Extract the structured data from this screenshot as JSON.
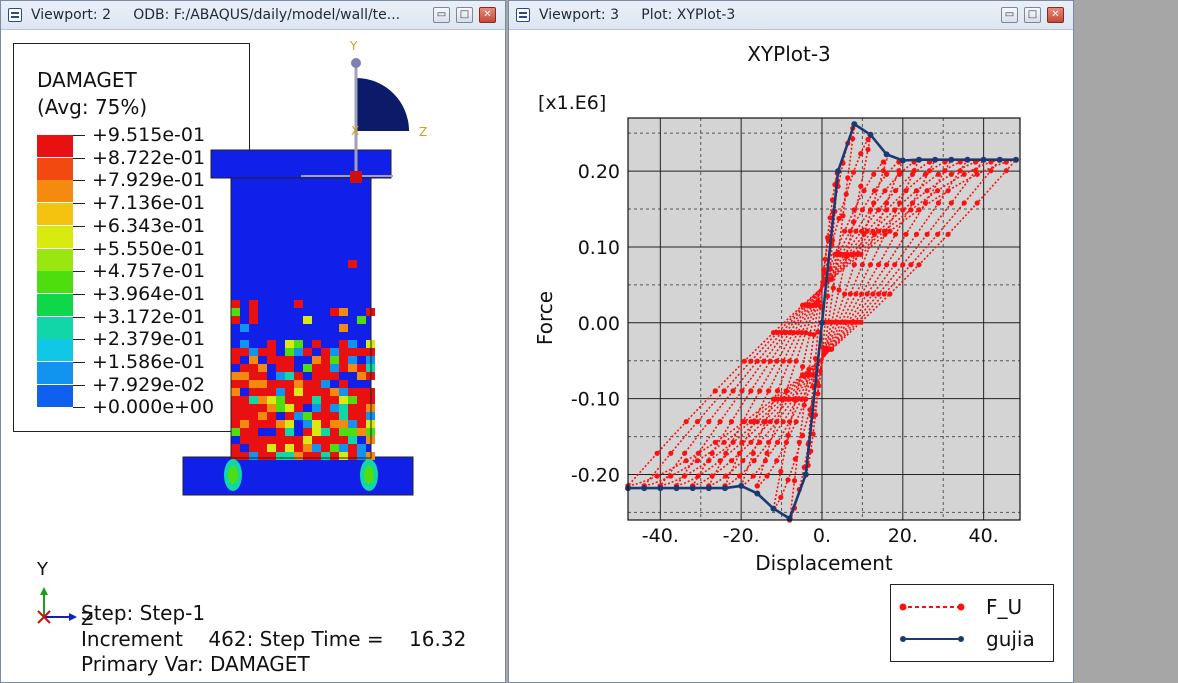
{
  "viewport2": {
    "title": "Viewport: 2     ODB: F:/ABAQUS/daily/model/wall/te...",
    "legend": {
      "title": "DAMAGET",
      "subtitle": "(Avg: 75%)",
      "levels": [
        "+9.515e-01",
        "+8.722e-01",
        "+7.929e-01",
        "+7.136e-01",
        "+6.343e-01",
        "+5.550e-01",
        "+4.757e-01",
        "+3.964e-01",
        "+3.172e-01",
        "+2.379e-01",
        "+1.586e-01",
        "+7.929e-02",
        "+0.000e+00"
      ],
      "colors": [
        "#e81010",
        "#f04a10",
        "#f58a10",
        "#f5c210",
        "#d8ea10",
        "#9ae610",
        "#4ede10",
        "#10d64a",
        "#10d6a8",
        "#10c8e6",
        "#1094f0",
        "#1060f0",
        "#1020e8"
      ]
    },
    "triad": {
      "y": "Y",
      "z": "Z",
      "x": "X"
    },
    "info": {
      "step": "Step: Step-1",
      "increment": "Increment    462: Step Time =    16.32",
      "primary": "Primary Var: DAMAGET"
    }
  },
  "viewport3": {
    "title": "Viewport: 3     Plot: XYPlot-3"
  },
  "chart_data": {
    "type": "line",
    "title": "XYPlot-3",
    "xlabel": "Displacement",
    "ylabel": "Force",
    "y_multiplier": "[x1.E6]",
    "xlim": [
      -48,
      49
    ],
    "ylim": [
      -0.26,
      0.27
    ],
    "x_ticks": [
      -40,
      -20,
      0,
      20,
      40
    ],
    "x_tick_labels": [
      "-40.",
      "-20.",
      "0.",
      "20.",
      "40."
    ],
    "y_ticks": [
      0.2,
      0.1,
      0.0,
      -0.1,
      -0.2
    ],
    "y_tick_labels": [
      "0.20",
      "0.10",
      "0.00",
      "-0.10",
      "-0.20"
    ],
    "grid": true,
    "legend_position": "bottom-right",
    "series": [
      {
        "name": "F_U",
        "color": "#ff1010",
        "cycles": [
          {
            "amp": 4,
            "fmax": 0.2
          },
          {
            "amp": 8,
            "fmax": 0.26
          },
          {
            "amp": 12,
            "fmax": 0.245
          },
          {
            "amp": 16,
            "fmax": 0.215
          },
          {
            "amp": 20,
            "fmax": 0.215
          },
          {
            "amp": 24,
            "fmax": 0.215
          },
          {
            "amp": 28,
            "fmax": 0.215
          },
          {
            "amp": 32,
            "fmax": 0.215
          },
          {
            "amp": 36,
            "fmax": 0.215
          },
          {
            "amp": 40,
            "fmax": 0.215
          },
          {
            "amp": 44,
            "fmax": 0.215
          },
          {
            "amp": 48,
            "fmax": 0.215
          }
        ]
      },
      {
        "name": "gujia",
        "color": "#1c3a72",
        "x": [
          -48,
          -44,
          -40,
          -36,
          -32,
          -28,
          -24,
          -20,
          -16,
          -12,
          -8,
          -4,
          0,
          4,
          8,
          12,
          16,
          20,
          24,
          28,
          32,
          36,
          40,
          44,
          48
        ],
        "y": [
          -0.218,
          -0.218,
          -0.218,
          -0.218,
          -0.218,
          -0.218,
          -0.218,
          -0.215,
          -0.225,
          -0.245,
          -0.258,
          -0.2,
          0,
          0.2,
          0.262,
          0.248,
          0.222,
          0.214,
          0.215,
          0.215,
          0.215,
          0.215,
          0.215,
          0.215,
          0.215
        ]
      }
    ]
  }
}
